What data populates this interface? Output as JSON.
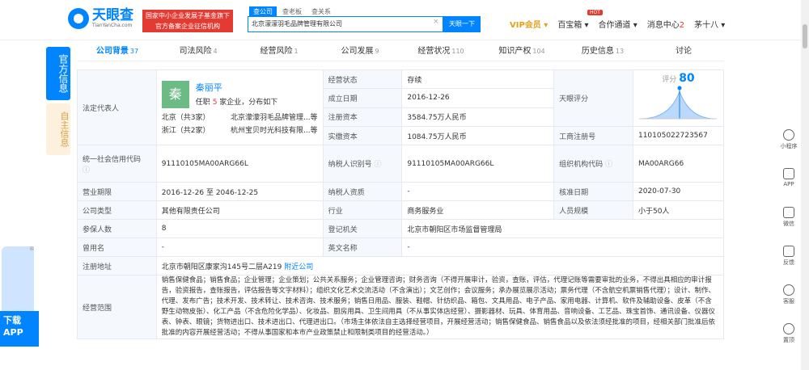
{
  "header": {
    "logo_cn": "天眼查",
    "logo_en": "TianYanCha.com",
    "promo_line1": "国家中小企业发展子基金旗下",
    "promo_line2": "官方备案企业征信机构",
    "search_tabs": [
      "查公司",
      "查老板",
      "查关系"
    ],
    "search_value": "北京濛濛羽毛品牌管理有限公司",
    "search_clear": "×",
    "search_button": "天眼一下",
    "vip": "VIP会员",
    "baixiang": "百宝箱",
    "hot": "HOT",
    "partner": "合作通道",
    "msg": "消息中心",
    "msg_count": "2",
    "user": "茅十八"
  },
  "left_tabs": [
    "官方信息",
    "自主信息"
  ],
  "tabs": [
    {
      "label": "公司背景",
      "count": "37"
    },
    {
      "label": "司法风险",
      "count": "4"
    },
    {
      "label": "经营风险",
      "count": "1"
    },
    {
      "label": "公司发展",
      "count": "9"
    },
    {
      "label": "经营状况",
      "count": "110"
    },
    {
      "label": "知识产权",
      "count": "104"
    },
    {
      "label": "历史信息",
      "count": "13"
    },
    {
      "label": "讨论",
      "count": ""
    }
  ],
  "info": {
    "legal_rep_label": "法定代表人",
    "avatar_char": "秦",
    "legal_name": "秦丽平",
    "legal_sub_pre": "任职",
    "legal_sub_num": "5",
    "legal_sub_post": "家企业，分布如下",
    "dist1_region": "北京（共3家）",
    "dist1_company": "北京濛濛羽毛品牌管理...等",
    "dist2_region": "浙江（共2家）",
    "dist2_company": "杭州宝贝时光科技有限...等",
    "status_label": "经营状态",
    "status": "存续",
    "found_label": "成立日期",
    "found": "2016-12-26",
    "capital_label": "注册资本",
    "capital": "3584.75万人民币",
    "paid_label": "实缴资本",
    "paid": "1084.75万人民币",
    "rating_label": "天眼评分",
    "rating_prefix": "评分",
    "rating_score": "80",
    "biz_reg_label": "工商注册号",
    "biz_reg": "110105022723567",
    "credit_label": "统一社会信用代码",
    "credit": "91110105MA00ARG66L",
    "taxid_label": "纳税人识别号",
    "taxid": "91110105MA00ARG66L",
    "org_label": "组织机构代码",
    "org": "MA00ARG66",
    "term_label": "营业期限",
    "term": "2016-12-26  至 2046-12-25",
    "tax_q_label": "纳税人资质",
    "tax_q": "-",
    "approve_label": "核准日期",
    "approve": "2020-07-30",
    "type_label": "公司类型",
    "type": "其他有限责任公司",
    "industry_label": "行业",
    "industry": "商务服务业",
    "staff_label": "人员规模",
    "staff": "小于50人",
    "insured_label": "参保人数",
    "insured": "8",
    "reg_auth_label": "登记机关",
    "reg_auth": "北京市朝阳区市场监督管理局",
    "former_label": "曾用名",
    "former": "-",
    "en_label": "英文名称",
    "en": "-",
    "addr_label": "注册地址",
    "addr": "北京市朝阳区康家沟145号二层A219",
    "addr_link": "附近公司",
    "scope_label": "经营范围",
    "scope": "销售保健食品；销售食品；企业管理；企业策划；公共关系服务；企业管理咨询；财务咨询（不得开展审计，验资，查账，评估，代理记账等需要审批的业务，不得出具相应的审计报告，验资报告，查账报告，评估报告等文字材料）；组织文化艺术交流活动（不含演出）；文艺创作；会议服务；承办展览展示活动；票务代理（不含航空机票销售代理）；设计、制作、代理、发布广告；技术开发、技术转让、技术咨询、技术服务；销售日用品、服装、鞋帽、针纺织品、箱包、文具用品、电子产品、家用电器、计算机、软件及辅助设备、皮革（不含野生动物皮张）、化工产品（不含危险化学品）、化妆品、厨房用具、卫生间用具（不从事实体店经营）、摄影器材、玩具、体育用品、音响设备、工艺品、珠宝首饰、通讯设备、仪器仪表、钟表、眼镜；货物进出口、技术进出口、代理进出口。（市场主体依法自主选择经营项目，开展经营活动；销售保健食品、销售食品以及依法须经批准的项目，经相关部门批准后依批准的内容开展经营活动；不得从事国家和本市产业政策禁止和限制类项目的经营活动。）"
  },
  "sidebar": [
    "小程序",
    "APP",
    "微信",
    "反馈",
    "客服",
    "置顶"
  ],
  "app_promo": {
    "line1": "下载",
    "line2": "APP"
  },
  "colors": {
    "brand": "#0084ff",
    "red": "#e33a31",
    "gold": "#e3a01b"
  }
}
